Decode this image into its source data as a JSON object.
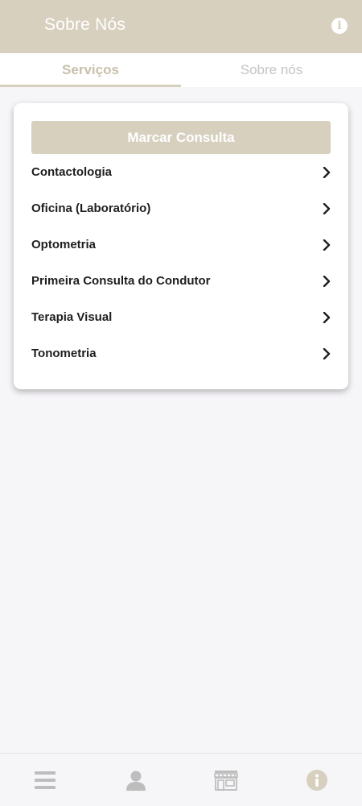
{
  "header": {
    "title": "Sobre Nós",
    "info_icon": "info-icon"
  },
  "tabs": [
    {
      "label": "Serviços",
      "active": true
    },
    {
      "label": "Sobre nós",
      "active": false
    }
  ],
  "card": {
    "cta_label": "Marcar Consulta",
    "items": [
      {
        "label": "Contactologia"
      },
      {
        "label": "Oficina (Laboratório)"
      },
      {
        "label": "Optometria"
      },
      {
        "label": "Primeira Consulta do Condutor"
      },
      {
        "label": "Terapia Visual"
      },
      {
        "label": "Tonometria"
      }
    ]
  },
  "bottom_nav": {
    "items": [
      {
        "icon": "menu-icon"
      },
      {
        "icon": "user-icon"
      },
      {
        "icon": "store-icon"
      },
      {
        "icon": "info-icon"
      }
    ]
  },
  "colors": {
    "brand": "#d8d0bf",
    "background": "#f6f5f8",
    "icon_gray": "#bdbdbd"
  }
}
